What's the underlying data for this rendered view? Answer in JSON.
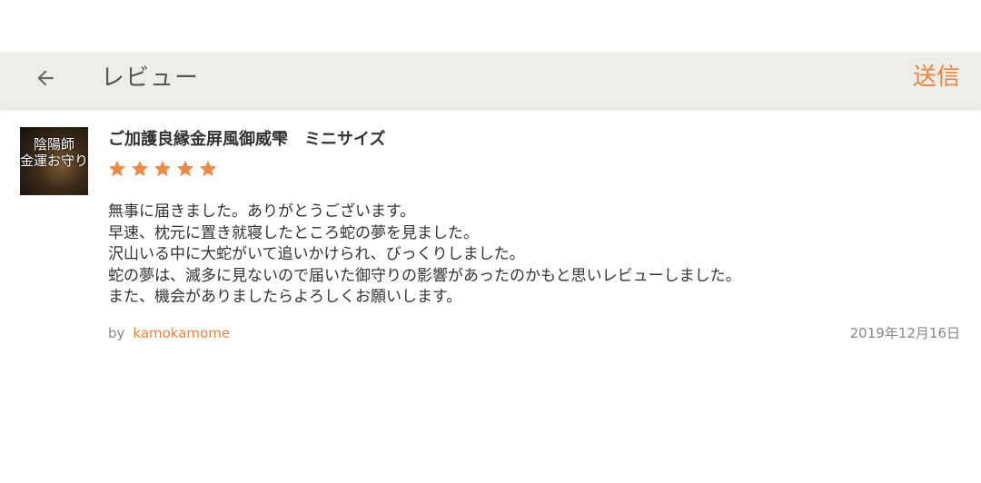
{
  "toolbar": {
    "back_icon": "arrow-left-icon",
    "title": "レビュー",
    "send_label": "送信",
    "background": "#eeede8",
    "accent": "#e8853e"
  },
  "review": {
    "thumbnail": {
      "icon": "product-thumbnail",
      "line1": "陰陽師",
      "line2": "金運お守り"
    },
    "product_title": "ご加護良縁金屏風御威雫　ミニサイズ",
    "rating": 5,
    "rating_max": 5,
    "star_color": "#ee8a45",
    "body_lines": [
      "無事に届きました。ありがとうございます。",
      "早速、枕元に置き就寝したところ蛇の夢を見ました。",
      "沢山いる中に大蛇がいて追いかけられ、びっくりしました。",
      "蛇の夢は、滅多に見ないので届いた御守りの影響があったのかもと思いレビューしました。",
      "また、機会がありましたらよろしくお願いします。"
    ],
    "by_label": "by",
    "author": "kamokamome",
    "date": "2019年12月16日"
  }
}
